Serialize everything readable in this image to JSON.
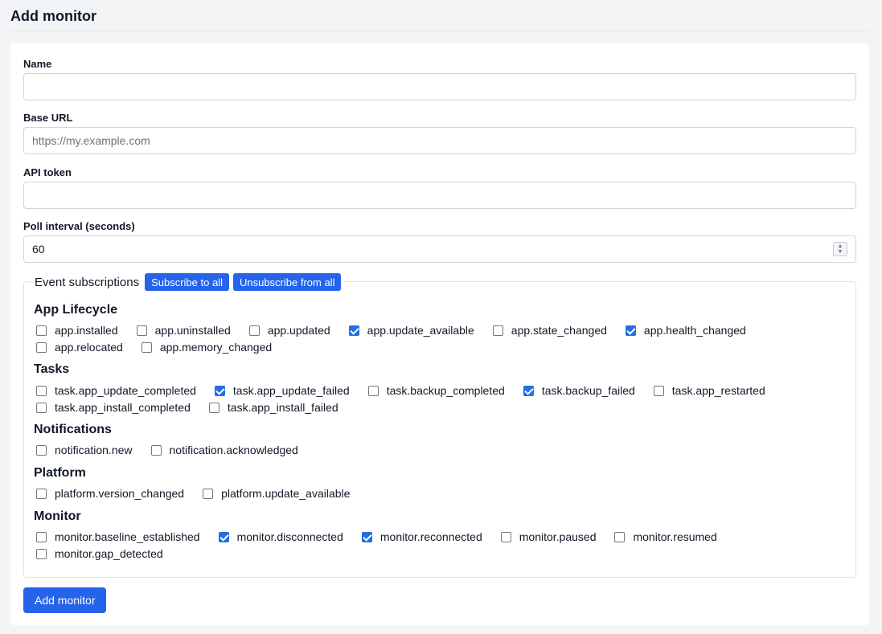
{
  "page": {
    "title": "Add monitor"
  },
  "form": {
    "name": {
      "label": "Name",
      "value": "",
      "placeholder": ""
    },
    "base_url": {
      "label": "Base URL",
      "value": "",
      "placeholder": "https://my.example.com"
    },
    "api_token": {
      "label": "API token",
      "value": "",
      "placeholder": ""
    },
    "poll_interval": {
      "label": "Poll interval (seconds)",
      "value": "60"
    },
    "submit_label": "Add monitor"
  },
  "subscriptions": {
    "legend": "Event subscriptions",
    "subscribe_all_label": "Subscribe to all",
    "unsubscribe_all_label": "Unsubscribe from all",
    "groups": [
      {
        "title": "App Lifecycle",
        "rows": [
          [
            {
              "label": "app.installed",
              "checked": false
            },
            {
              "label": "app.uninstalled",
              "checked": false
            },
            {
              "label": "app.updated",
              "checked": false
            },
            {
              "label": "app.update_available",
              "checked": true
            },
            {
              "label": "app.state_changed",
              "checked": false
            },
            {
              "label": "app.health_changed",
              "checked": true
            }
          ],
          [
            {
              "label": "app.relocated",
              "checked": false
            },
            {
              "label": "app.memory_changed",
              "checked": false
            }
          ]
        ]
      },
      {
        "title": "Tasks",
        "rows": [
          [
            {
              "label": "task.app_update_completed",
              "checked": false
            },
            {
              "label": "task.app_update_failed",
              "checked": true
            },
            {
              "label": "task.backup_completed",
              "checked": false
            },
            {
              "label": "task.backup_failed",
              "checked": true
            },
            {
              "label": "task.app_restarted",
              "checked": false
            }
          ],
          [
            {
              "label": "task.app_install_completed",
              "checked": false
            },
            {
              "label": "task.app_install_failed",
              "checked": false
            }
          ]
        ]
      },
      {
        "title": "Notifications",
        "rows": [
          [
            {
              "label": "notification.new",
              "checked": false
            },
            {
              "label": "notification.acknowledged",
              "checked": false
            }
          ]
        ]
      },
      {
        "title": "Platform",
        "rows": [
          [
            {
              "label": "platform.version_changed",
              "checked": false
            },
            {
              "label": "platform.update_available",
              "checked": false
            }
          ]
        ]
      },
      {
        "title": "Monitor",
        "rows": [
          [
            {
              "label": "monitor.baseline_established",
              "checked": false
            },
            {
              "label": "monitor.disconnected",
              "checked": true
            },
            {
              "label": "monitor.reconnected",
              "checked": true
            },
            {
              "label": "monitor.paused",
              "checked": false
            },
            {
              "label": "monitor.resumed",
              "checked": false
            }
          ],
          [
            {
              "label": "monitor.gap_detected",
              "checked": false
            }
          ]
        ]
      }
    ]
  }
}
